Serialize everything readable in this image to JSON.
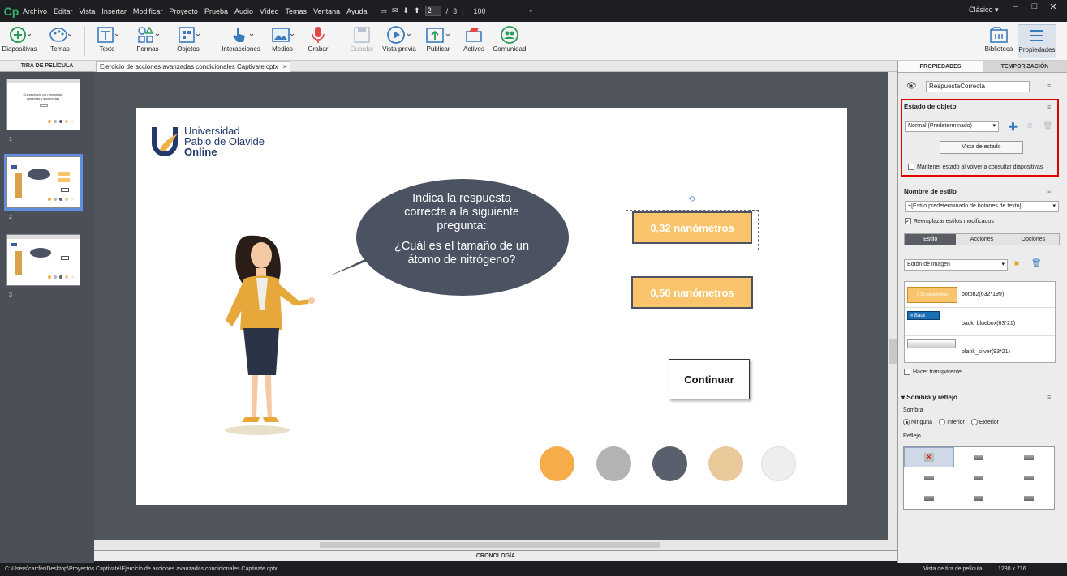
{
  "menubar": {
    "logo": "Cp",
    "items": [
      "Archivo",
      "Editar",
      "Vista",
      "Insertar",
      "Modificar",
      "Proyecto",
      "Prueba",
      "Audio",
      "Vídeo",
      "Temas",
      "Ventana",
      "Ayuda"
    ],
    "page_current": "2",
    "page_sep": "/",
    "page_total": "3",
    "zoom": "100",
    "workspace": "Clásico"
  },
  "toolbar": {
    "diapositivas": "Diapositivas",
    "temas": "Temas",
    "texto": "Texto",
    "formas": "Formas",
    "objetos": "Objetos",
    "interacciones": "Interacciones",
    "medios": "Medios",
    "grabar": "Grabar",
    "guardar": "Guardar",
    "vista_previa": "Vista previa",
    "publicar": "Publicar",
    "activos": "Activos",
    "comunidad": "Comunidad",
    "biblioteca": "Biblioteca",
    "propiedades": "Propiedades"
  },
  "filmstrip": {
    "title": "TIRA DE PELÍCULA",
    "thumbs": [
      {
        "num": "1",
        "title": "Cuestionario con preguntas correctas y incorrectas"
      },
      {
        "num": "2"
      },
      {
        "num": "3"
      }
    ]
  },
  "doc": {
    "tab": "Ejercicio de acciones avanzadas condicionales Captivate.cptx",
    "close": "×"
  },
  "slide": {
    "logo_line1": "Universidad",
    "logo_line2": "Pablo de Olavide",
    "logo_line3": "Online",
    "bubble_line1": "Indica la respuesta",
    "bubble_line2": "correcta a la siguiente",
    "bubble_line3": "pregunta:",
    "bubble_line4": "¿Cuál es el tamaño de un",
    "bubble_line5": "átomo de nitrógeno?",
    "answer1": "0,32 nanómetros",
    "answer2": "0,50 nanómetros",
    "continue": "Continuar",
    "dots": [
      "#f7ac4a",
      "#b2b3b5",
      "#5a5f6e",
      "#e9c89a",
      "#eeeeee"
    ]
  },
  "timeline": {
    "label": "CRONOLOGÍA"
  },
  "statusbar": {
    "path": "C:\\Users\\carrfer\\Desktop\\Proyectos Captivate\\Ejercicio de acciones avanzadas condicionales Captivate.cptx",
    "view": "Vista de tira de película",
    "size": "1280 x 716"
  },
  "props": {
    "tab_props": "PROPIEDADES",
    "tab_timing": "TEMPORIZACIÓN",
    "object_name": "RespuestaCorrecta",
    "state_title": "Estado de objeto",
    "state_value": "Normal (Predeterminado)",
    "state_view_btn": "Vista de estado",
    "keep_state": "Mantener estado al volver a consultar diapositivas",
    "style_title": "Nombre de estilo",
    "style_value": "+[Estilo predeterminado de botones de texto]",
    "replace_styles": "Reemplazar estilos modificados",
    "subtab_style": "Estilo",
    "subtab_actions": "Acciones",
    "subtab_options": "Opciones",
    "button_type": "Botón de imagen",
    "images": [
      {
        "preview": "0,50 nanómetros",
        "name": "boton2(632*199)"
      },
      {
        "preview": "« Back",
        "name": "back_bluebox(63*21)"
      },
      {
        "preview": "",
        "name": "blank_silver(93*21)"
      }
    ],
    "transparent": "Hacer transparente",
    "shadow_title": "Sombra y reflejo",
    "shadow_label": "Sombra",
    "shadow_none": "Ninguna",
    "shadow_inner": "Interior",
    "shadow_outer": "Exterior",
    "reflection_label": "Reflejo",
    "highlight_color": "#e00000"
  }
}
